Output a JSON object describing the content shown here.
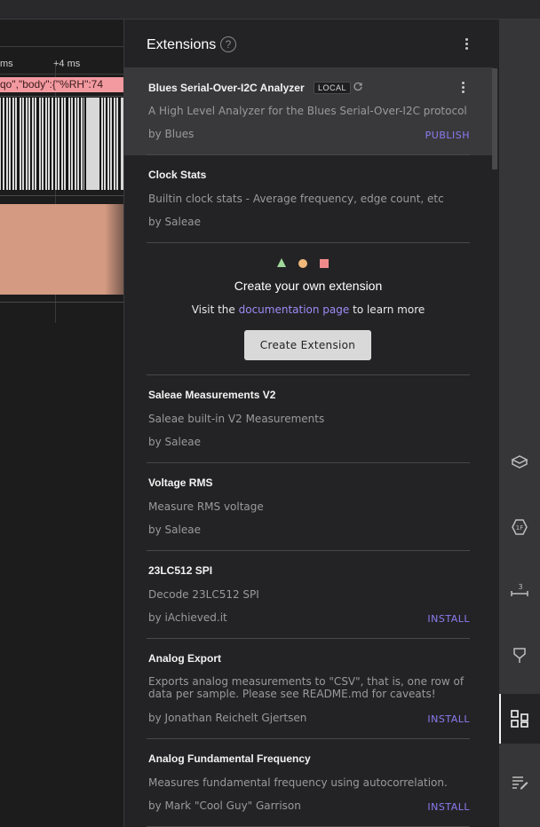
{
  "timeline": {
    "tick_left": "ms",
    "tick_right": "+4 ms",
    "decoded_text": "qo\",\"body\":{\"%RH\":74"
  },
  "panel": {
    "title": "Extensions",
    "help_icon": "help-circle-icon",
    "menu_icon": "more-vert-icon"
  },
  "extensions": [
    {
      "name": "Blues Serial-Over-I2C Analyzer",
      "badge": "LOCAL",
      "description": "A High Level Analyzer for the Blues Serial-Over-I2C protocol",
      "author": "by Blues",
      "action": "PUBLISH"
    },
    {
      "name": "Clock Stats",
      "description": "Builtin clock stats - Average frequency, edge count, etc",
      "author": "by Saleae",
      "action": ""
    },
    {
      "name": "Saleae Measurements V2",
      "description": "Saleae built-in V2 Measurements",
      "author": "by Saleae",
      "action": ""
    },
    {
      "name": "Voltage RMS",
      "description": "Measure RMS voltage",
      "author": "by Saleae",
      "action": ""
    },
    {
      "name": "23LC512 SPI",
      "description": "Decode 23LC512 SPI",
      "author": "by iAchieved.it",
      "action": "INSTALL"
    },
    {
      "name": "Analog Export",
      "description": "Exports analog measurements to \"CSV\", that is, one row of data per sample. Please see README.md for caveats!",
      "author": "by Jonathan Reichelt Gjertsen",
      "action": "INSTALL"
    },
    {
      "name": "Analog Fundamental Frequency",
      "description": "Measures fundamental frequency using autocorrelation.",
      "author": "by Mark \"Cool Guy\" Garrison",
      "action": "INSTALL"
    }
  ],
  "create": {
    "title": "Create your own extension",
    "sub_prefix": "Visit the",
    "sub_link": "documentation page",
    "sub_suffix": "to learn more",
    "button": "Create Extension",
    "shape_colors": [
      "#9fd89a",
      "#f0b97a",
      "#f08a8a"
    ]
  },
  "rail": {
    "icons": [
      "analyzers-icon",
      "hex-value-icon",
      "measure-icon",
      "timing-marker-icon",
      "extensions-icon",
      "notes-icon"
    ],
    "active": "extensions-icon"
  }
}
